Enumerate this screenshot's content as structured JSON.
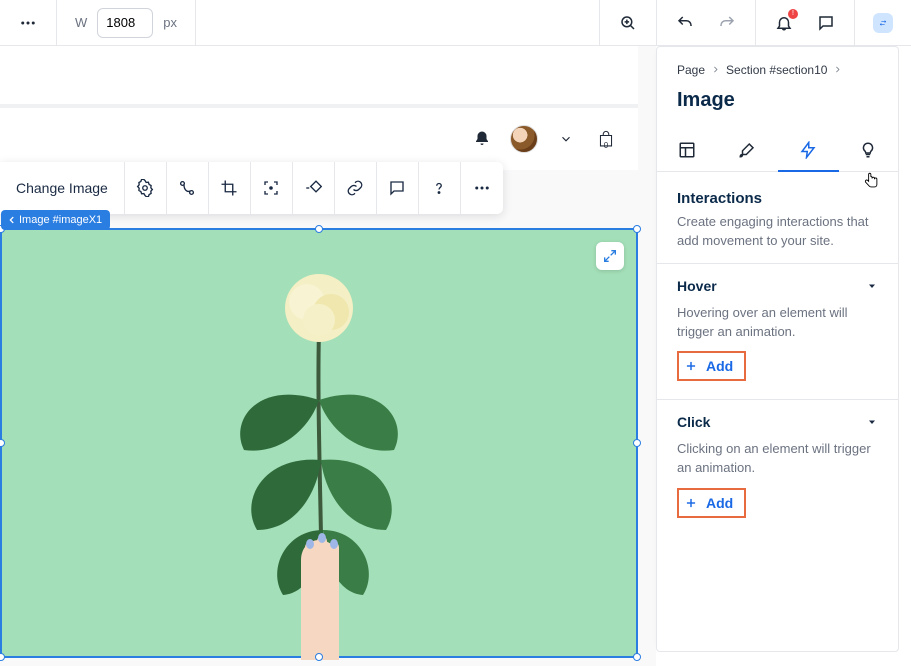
{
  "topbar": {
    "width_label": "W",
    "width_value": "1808",
    "width_unit": "px"
  },
  "floating_toolbar": {
    "main_label": "Change Image"
  },
  "selection": {
    "tag": "Image #imageX1"
  },
  "site_header": {
    "bag_count": "0"
  },
  "notification": {
    "badge": "!"
  },
  "right_panel": {
    "breadcrumb": [
      "Page",
      "Section #section10"
    ],
    "title": "Image",
    "section": {
      "title": "Interactions",
      "desc": "Create engaging interactions that add movement to your site."
    },
    "triggers": [
      {
        "name": "Hover",
        "desc": "Hovering over an element will trigger an animation.",
        "add_label": "Add"
      },
      {
        "name": "Click",
        "desc": "Clicking on an element will trigger an animation.",
        "add_label": "Add"
      }
    ]
  }
}
